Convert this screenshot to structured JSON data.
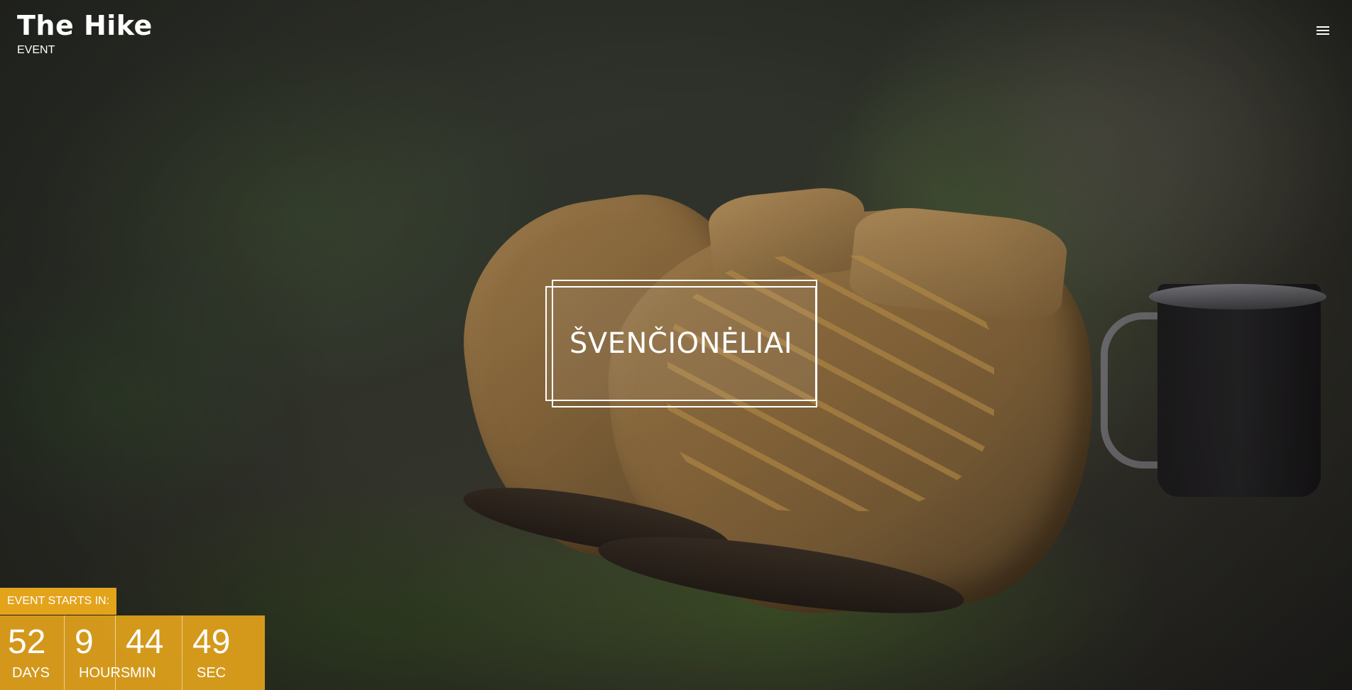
{
  "brand": {
    "title": "The Hike",
    "subtitle": "EVENT"
  },
  "menu": {
    "icon": "hamburger-menu-icon"
  },
  "hero": {
    "title": "ŠVENČIONĖLIAI"
  },
  "countdown": {
    "label": "EVENT STARTS IN:",
    "days": {
      "value": "52",
      "label": "DAYS"
    },
    "hours": {
      "value": "9",
      "label": "HOURS"
    },
    "minutes": {
      "value": "44",
      "label": "MIN"
    },
    "seconds": {
      "value": "49",
      "label": "SEC"
    }
  },
  "colors": {
    "accent": "#e3a31b",
    "text": "#ffffff"
  }
}
